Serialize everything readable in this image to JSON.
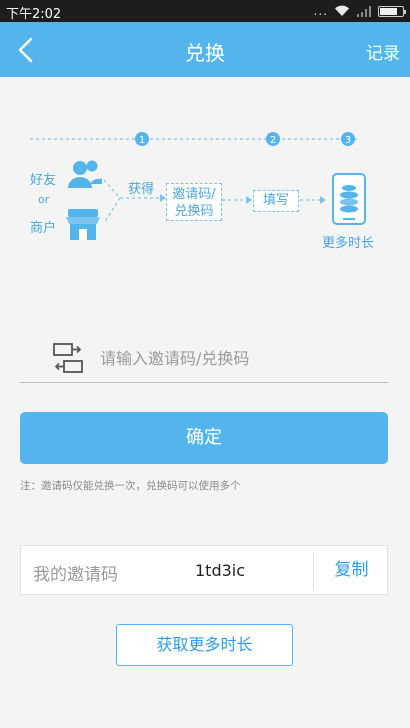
{
  "status_bar": {
    "time": "下午2:02",
    "dots": "..."
  },
  "nav": {
    "title": "兑换",
    "record": "记录"
  },
  "flow": {
    "step_numbers": [
      "1",
      "2",
      "3"
    ],
    "friend": "好友",
    "or": "or",
    "merchant": "商户",
    "obtain": "获得",
    "code_box_line1": "邀请码/",
    "code_box_line2": "兑换码",
    "fill": "填写",
    "more_time": "更多时长"
  },
  "input": {
    "placeholder": "请输入邀请码/兑换码",
    "value": ""
  },
  "confirm_label": "确定",
  "note": "注：邀请码仅能兑换一次，兑换码可以使用多个",
  "invite": {
    "label": "我的邀请码",
    "code": "1td3ic",
    "copy_label": "复制"
  },
  "more_time_button": "获取更多时长",
  "colors": {
    "primary": "#54b5ec",
    "accent_text": "#2f9ee6",
    "flow_text": "#4aa6e0"
  }
}
